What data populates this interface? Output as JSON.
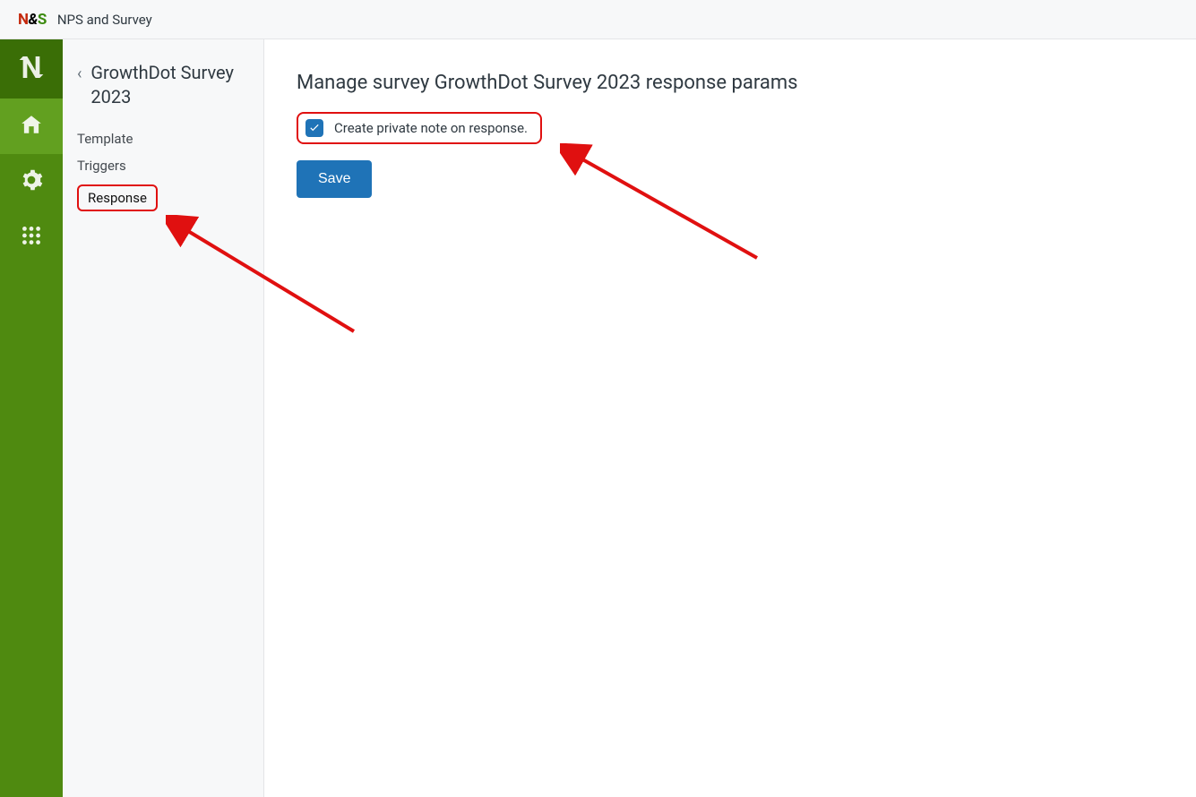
{
  "header": {
    "app_name": "NPS and Survey"
  },
  "nav_rail": {
    "items": [
      {
        "name": "n-logo-icon"
      },
      {
        "name": "home-icon"
      },
      {
        "name": "gear-icon"
      },
      {
        "name": "apps-grid-icon"
      }
    ]
  },
  "side_panel": {
    "title": "GrowthDot Survey 2023",
    "menu": [
      {
        "label": "Template",
        "active": false
      },
      {
        "label": "Triggers",
        "active": false
      },
      {
        "label": "Response",
        "active": true
      }
    ]
  },
  "main": {
    "heading": "Manage survey GrowthDot Survey 2023 response params",
    "checkbox": {
      "label": "Create private note on response.",
      "checked": true
    },
    "save_label": "Save"
  }
}
